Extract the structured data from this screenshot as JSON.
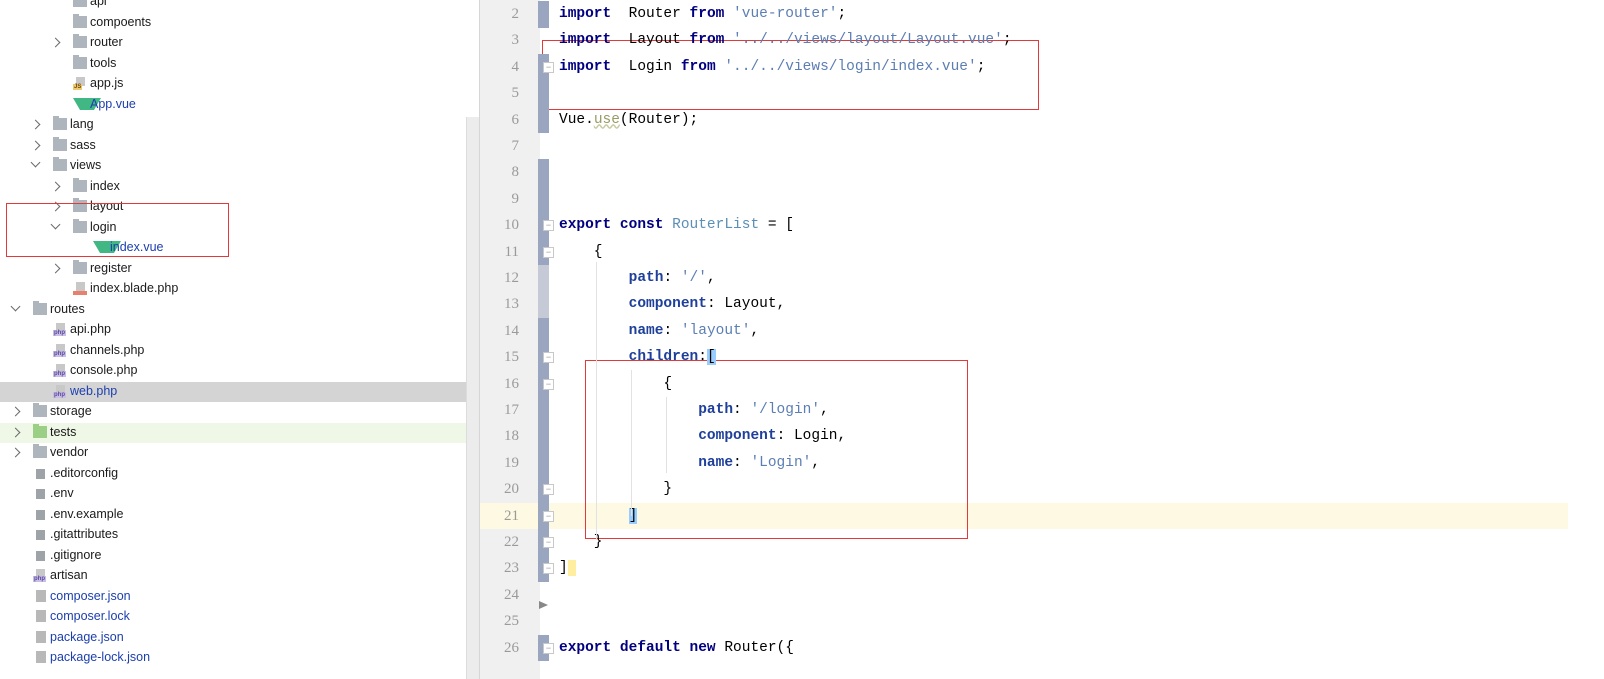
{
  "project_tree": {
    "items": [
      {
        "label": "api",
        "depth": 2,
        "type": "folder",
        "chevron": "none"
      },
      {
        "label": "compoents",
        "depth": 2,
        "type": "folder",
        "chevron": "none"
      },
      {
        "label": "router",
        "depth": 2,
        "type": "folder",
        "chevron": "closed"
      },
      {
        "label": "tools",
        "depth": 2,
        "type": "folder",
        "chevron": "none"
      },
      {
        "label": "app.js",
        "depth": 2,
        "type": "js"
      },
      {
        "label": "App.vue",
        "depth": 2,
        "type": "vue",
        "blue": true
      },
      {
        "label": "lang",
        "depth": 1,
        "type": "folder",
        "chevron": "closed"
      },
      {
        "label": "sass",
        "depth": 1,
        "type": "folder",
        "chevron": "closed"
      },
      {
        "label": "views",
        "depth": 1,
        "type": "folder",
        "chevron": "open"
      },
      {
        "label": "index",
        "depth": 2,
        "type": "folder",
        "chevron": "closed"
      },
      {
        "label": "layout",
        "depth": 2,
        "type": "folder",
        "chevron": "closed"
      },
      {
        "label": "login",
        "depth": 2,
        "type": "folder",
        "chevron": "open"
      },
      {
        "label": "index.vue",
        "depth": 3,
        "type": "vue",
        "blue": true
      },
      {
        "label": "register",
        "depth": 2,
        "type": "folder",
        "chevron": "closed"
      },
      {
        "label": "index.blade.php",
        "depth": 2,
        "type": "blade"
      },
      {
        "label": "routes",
        "depth": 0,
        "type": "folder",
        "chevron": "open"
      },
      {
        "label": "api.php",
        "depth": 1,
        "type": "php"
      },
      {
        "label": "channels.php",
        "depth": 1,
        "type": "php"
      },
      {
        "label": "console.php",
        "depth": 1,
        "type": "php"
      },
      {
        "label": "web.php",
        "depth": 1,
        "type": "php",
        "blue": true,
        "selected": true
      },
      {
        "label": "storage",
        "depth": 0,
        "type": "folder",
        "chevron": "closed"
      },
      {
        "label": "tests",
        "depth": 0,
        "type": "folder",
        "chevron": "closed",
        "green": true
      },
      {
        "label": "vendor",
        "depth": 0,
        "type": "folder",
        "chevron": "closed"
      },
      {
        "label": ".editorconfig",
        "depth": 0,
        "type": "text"
      },
      {
        "label": ".env",
        "depth": 0,
        "type": "text"
      },
      {
        "label": ".env.example",
        "depth": 0,
        "type": "text"
      },
      {
        "label": ".gitattributes",
        "depth": 0,
        "type": "text"
      },
      {
        "label": ".gitignore",
        "depth": 0,
        "type": "text"
      },
      {
        "label": "artisan",
        "depth": 0,
        "type": "php"
      },
      {
        "label": "composer.json",
        "depth": 0,
        "type": "json",
        "blue": true
      },
      {
        "label": "composer.lock",
        "depth": 0,
        "type": "json",
        "blue": true
      },
      {
        "label": "package.json",
        "depth": 0,
        "type": "json",
        "blue": true
      },
      {
        "label": "package-lock.json",
        "depth": 0,
        "type": "json",
        "blue": true
      }
    ]
  },
  "editor": {
    "current_line": 21,
    "lines": [
      {
        "n": "2",
        "tokens": [
          [
            "kw",
            "import"
          ],
          [
            "",
            "  Router "
          ],
          [
            "kw",
            "from"
          ],
          [
            "str",
            " 'vue-router'"
          ],
          [
            "",
            ";"
          ]
        ]
      },
      {
        "n": "3",
        "tokens": [
          [
            "kw",
            "import"
          ],
          [
            "",
            "  Layout "
          ],
          [
            "kw",
            "from"
          ],
          [
            "str",
            " '../../views/layout/Layout.vue'"
          ],
          [
            "",
            ";"
          ]
        ]
      },
      {
        "n": "4",
        "tokens": [
          [
            "kw",
            "import"
          ],
          [
            "",
            "  Login "
          ],
          [
            "kw",
            "from"
          ],
          [
            "str",
            " '../../views/login/index.vue'"
          ],
          [
            "",
            ";"
          ]
        ]
      },
      {
        "n": "5",
        "tokens": []
      },
      {
        "n": "6",
        "tokens": [
          [
            "",
            "Vue."
          ],
          [
            "fn",
            "use"
          ],
          [
            "",
            "(Router);"
          ]
        ]
      },
      {
        "n": "7",
        "tokens": []
      },
      {
        "n": "8",
        "tokens": []
      },
      {
        "n": "9",
        "tokens": []
      },
      {
        "n": "10",
        "tokens": [
          [
            "kw",
            "export const"
          ],
          [
            "",
            " "
          ],
          [
            "ident",
            "RouterList"
          ],
          [
            "",
            " = ["
          ]
        ]
      },
      {
        "n": "11",
        "tokens": [
          [
            "",
            "    {"
          ]
        ]
      },
      {
        "n": "12",
        "tokens": [
          [
            "",
            "        "
          ],
          [
            "prop",
            "path"
          ],
          [
            "",
            ": "
          ],
          [
            "str",
            "'/'"
          ],
          [
            "",
            ","
          ]
        ]
      },
      {
        "n": "13",
        "tokens": [
          [
            "",
            "        "
          ],
          [
            "prop",
            "component"
          ],
          [
            "",
            ": Layout,"
          ]
        ]
      },
      {
        "n": "14",
        "tokens": [
          [
            "",
            "        "
          ],
          [
            "prop",
            "name"
          ],
          [
            "",
            ": "
          ],
          [
            "str",
            "'layout'"
          ],
          [
            "",
            ","
          ]
        ]
      },
      {
        "n": "15",
        "tokens": [
          [
            "",
            "        "
          ],
          [
            "prop",
            "children"
          ],
          [
            "",
            ":"
          ],
          [
            "brmatch",
            "["
          ]
        ]
      },
      {
        "n": "16",
        "tokens": [
          [
            "",
            "            {"
          ]
        ]
      },
      {
        "n": "17",
        "tokens": [
          [
            "",
            "                "
          ],
          [
            "prop",
            "path"
          ],
          [
            "",
            ": "
          ],
          [
            "str",
            "'/login'"
          ],
          [
            "",
            ","
          ]
        ]
      },
      {
        "n": "18",
        "tokens": [
          [
            "",
            "                "
          ],
          [
            "prop",
            "component"
          ],
          [
            "",
            ": Login,"
          ]
        ]
      },
      {
        "n": "19",
        "tokens": [
          [
            "",
            "                "
          ],
          [
            "prop",
            "name"
          ],
          [
            "",
            ": "
          ],
          [
            "str",
            "'Login'"
          ],
          [
            "",
            ","
          ]
        ]
      },
      {
        "n": "20",
        "tokens": [
          [
            "",
            "            }"
          ]
        ]
      },
      {
        "n": "21",
        "tokens": [
          [
            "",
            "        "
          ],
          [
            "brmatch",
            "]"
          ]
        ]
      },
      {
        "n": "22",
        "tokens": [
          [
            "",
            "    }"
          ]
        ]
      },
      {
        "n": "23",
        "tokens": [
          [
            "",
            "]"
          ],
          [
            "brmatch2",
            " "
          ]
        ]
      },
      {
        "n": "24",
        "tokens": []
      },
      {
        "n": "25",
        "tokens": []
      },
      {
        "n": "26",
        "tokens": [
          [
            "kw",
            "export default new"
          ],
          [
            "",
            " Router({"
          ]
        ]
      }
    ]
  },
  "colors": {
    "annotation_box": "#e23a3a",
    "change_marker": "#9aa6bf",
    "current_line": "#fdf9e3",
    "selection": "#d4d4d4"
  }
}
